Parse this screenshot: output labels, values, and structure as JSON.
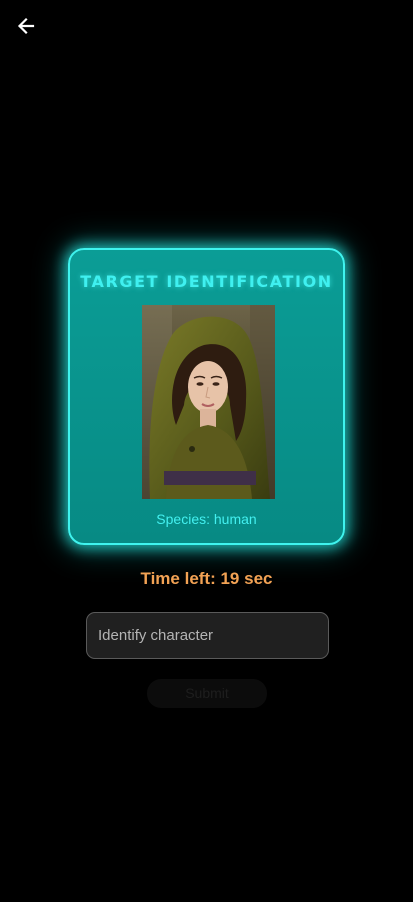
{
  "header": {
    "back_icon": "arrow-left-icon"
  },
  "card": {
    "title": "TARGET IDENTIFICATION",
    "species": "Species: human",
    "accent_color": "#3ff3ee",
    "background_color": "#0b9d96"
  },
  "timer": {
    "text": "Time left: 19 sec",
    "color": "#f2a254"
  },
  "answer_input": {
    "placeholder": "Identify character",
    "value": ""
  },
  "submit": {
    "label": "Submit",
    "enabled": false
  }
}
